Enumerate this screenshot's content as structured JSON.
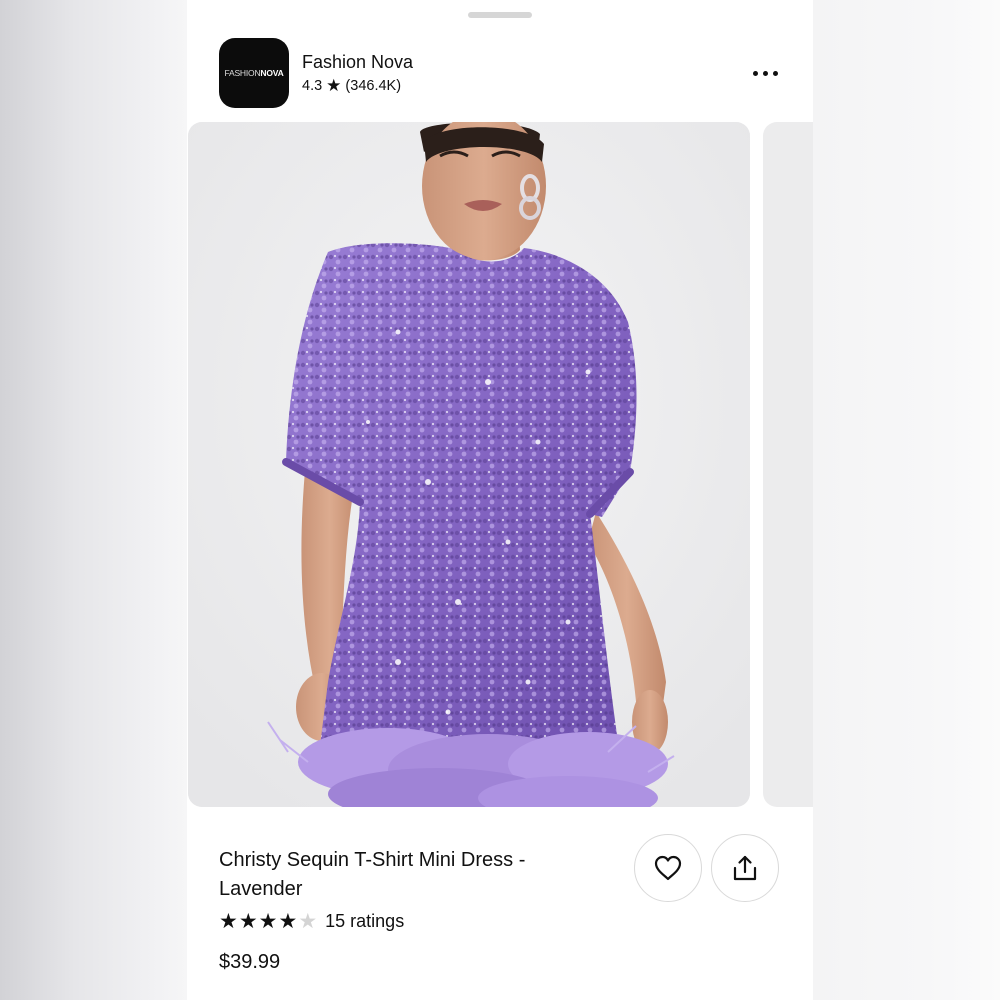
{
  "store": {
    "logo_text_thin": "FASHION",
    "logo_text_bold": "NOVA",
    "name": "Fashion Nova",
    "rating": "4.3",
    "rating_count": "(346.4K)"
  },
  "product": {
    "title": "Christy Sequin T-Shirt Mini Dress - Lavender",
    "stars_filled": 4,
    "stars_total": 5,
    "ratings_label": "15 ratings",
    "price": "$39.99"
  },
  "icons": {
    "more": "more-horizontal-icon",
    "rating_star": "star-icon",
    "like": "heart-icon",
    "share": "share-icon"
  },
  "colors": {
    "dress": "#8a6bc8",
    "dress_dark": "#5b3f94",
    "feather": "#b49ae6",
    "background": "#ebebec"
  }
}
